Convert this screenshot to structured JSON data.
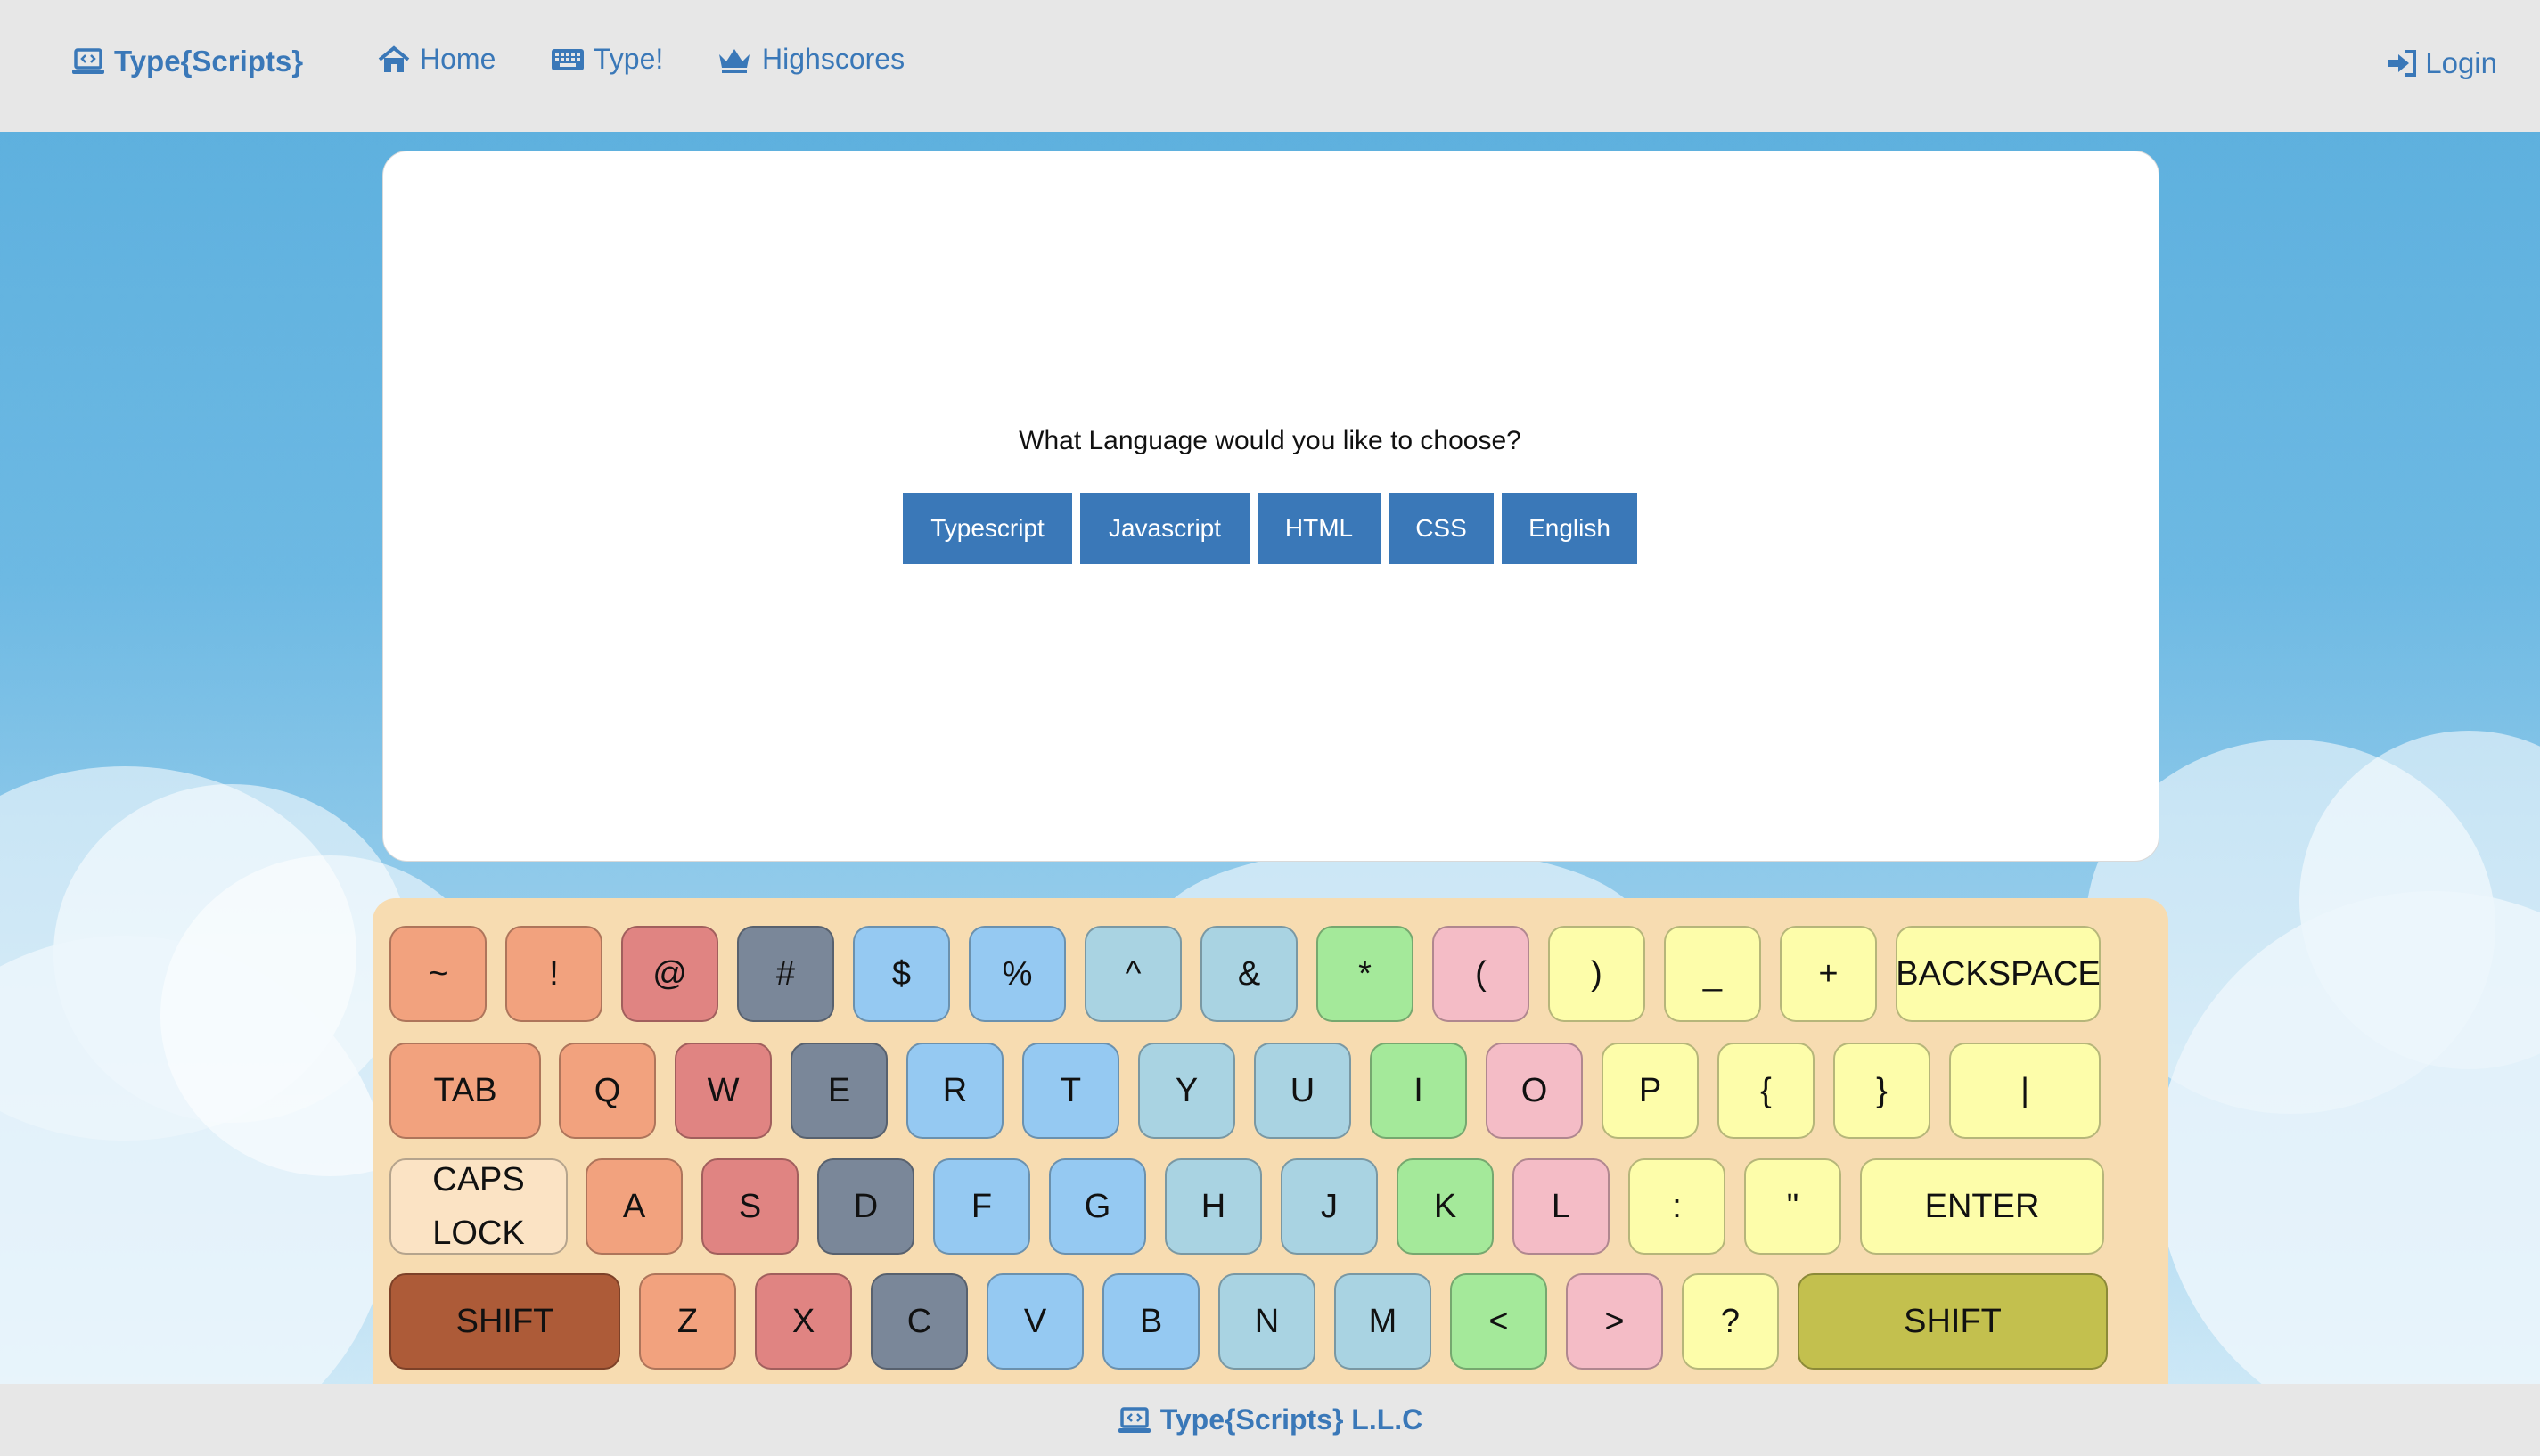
{
  "nav": {
    "brand": "Type{Scripts}",
    "home": "Home",
    "type": "Type!",
    "highscores": "Highscores",
    "login": "Login"
  },
  "main": {
    "question": "What Language would you like to choose?",
    "languages": [
      "Typescript",
      "Javascript",
      "HTML",
      "CSS",
      "English"
    ]
  },
  "keyboard": {
    "rows": [
      [
        "~",
        "!",
        "@",
        "#",
        "$",
        "%",
        "^",
        "&",
        "*",
        "(",
        ")",
        "_",
        "+",
        "BACKSPACE"
      ],
      [
        "TAB",
        "Q",
        "W",
        "E",
        "R",
        "T",
        "Y",
        "U",
        "I",
        "O",
        "P",
        "{",
        "}",
        "|"
      ],
      [
        "CAPS\nLOCK",
        "A",
        "S",
        "D",
        "F",
        "G",
        "H",
        "J",
        "K",
        "L",
        ":",
        "\"",
        "ENTER"
      ],
      [
        "SHIFT",
        "Z",
        "X",
        "C",
        "V",
        "B",
        "N",
        "M",
        "<",
        ">",
        "?",
        "SHIFT"
      ]
    ],
    "colors": {
      "orange": "#f2a27e",
      "red": "#e08482",
      "slate": "#7a8799",
      "blue": "#95c9f2",
      "lightblue": "#a9d3e2",
      "green": "#a4e99a",
      "pink": "#f4bcc6",
      "yellow": "#fdfdaa",
      "beige": "#fbe3c4",
      "brown": "#ad5b38",
      "olive": "#c3c04e"
    }
  },
  "footer": {
    "text": "Type{Scripts} L.L.C"
  }
}
